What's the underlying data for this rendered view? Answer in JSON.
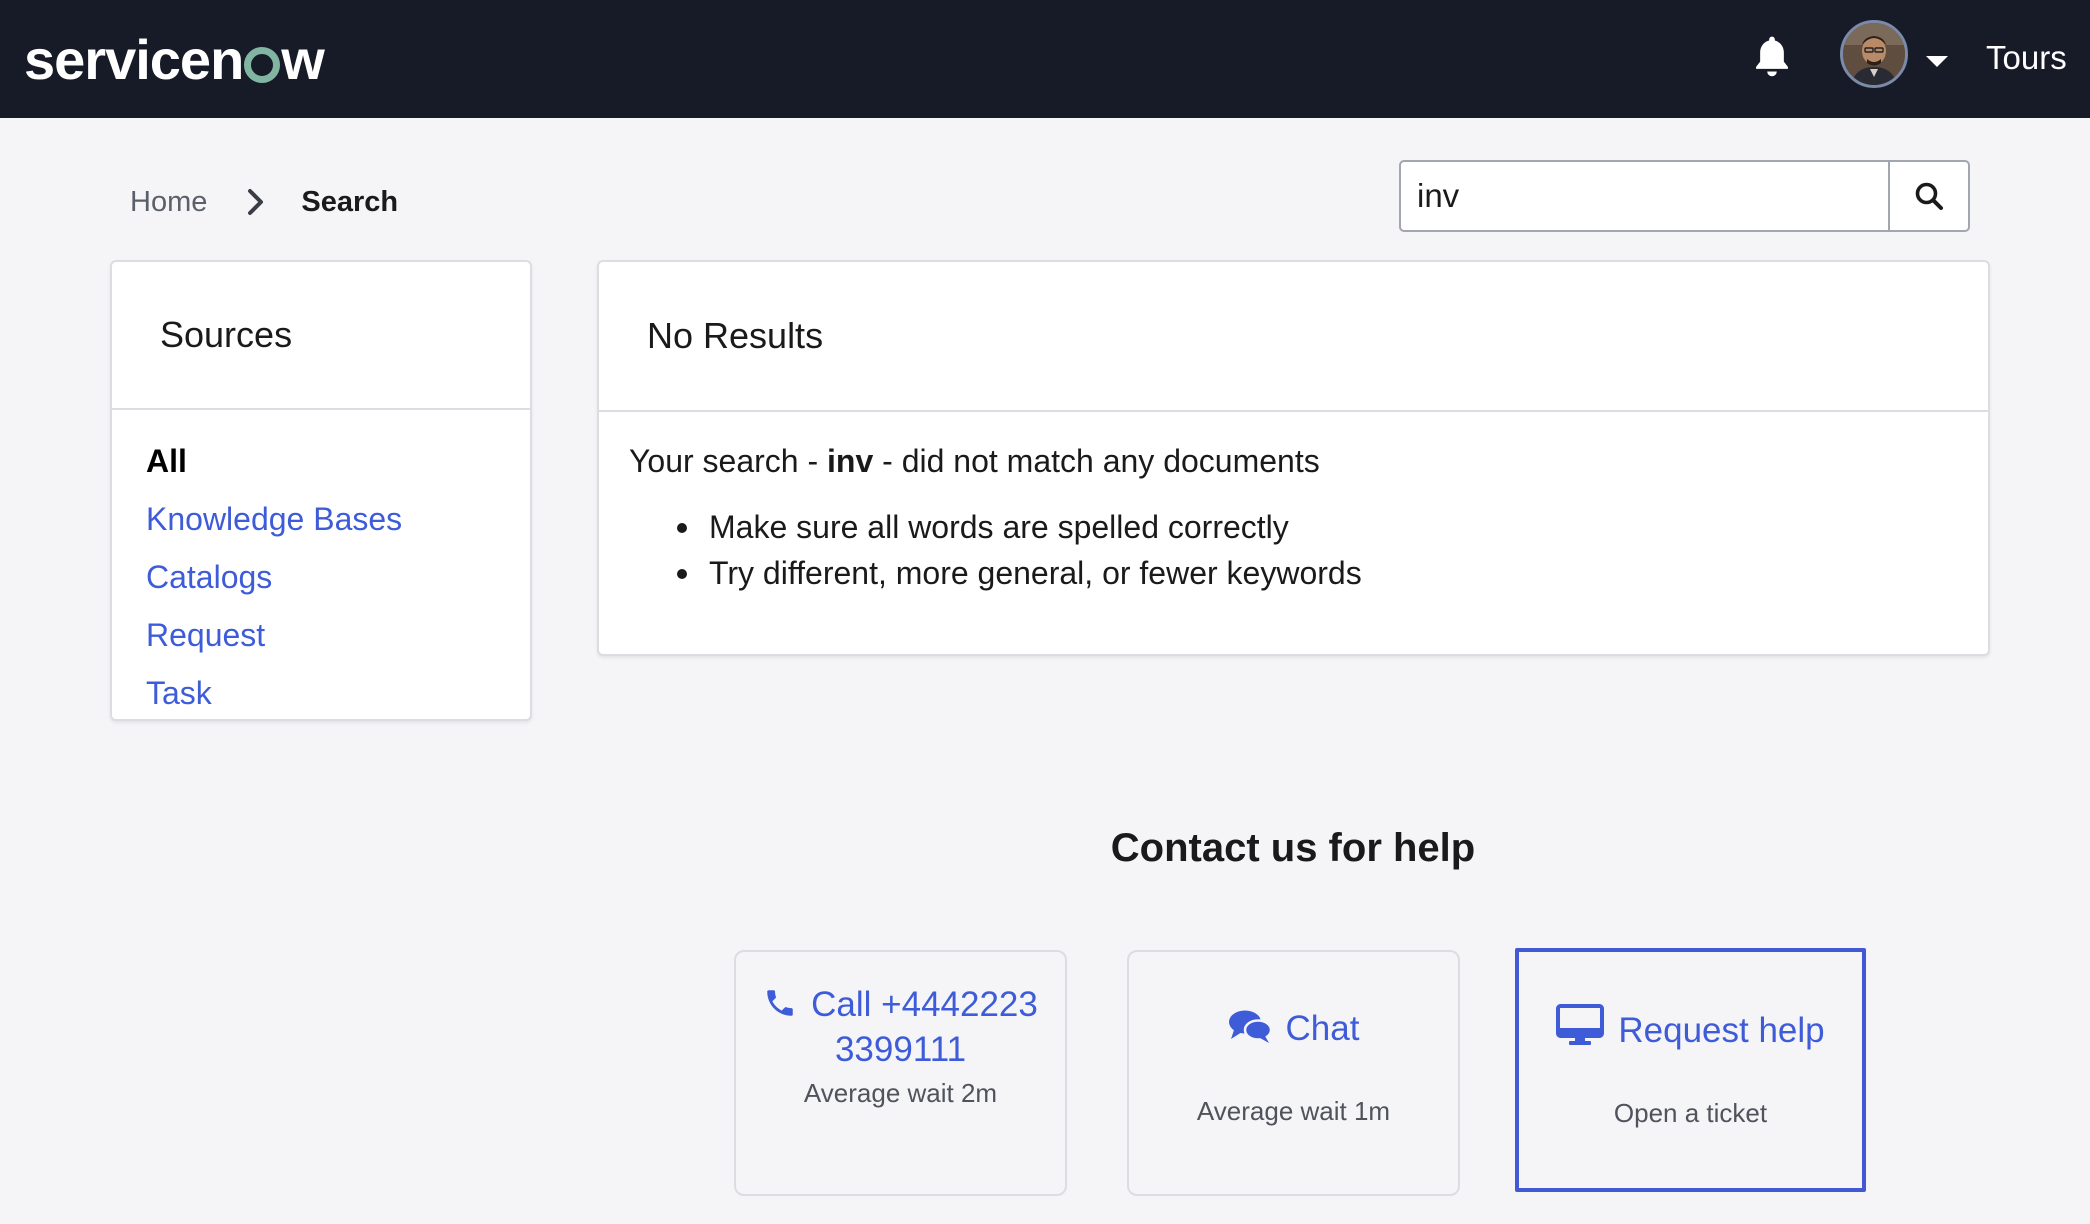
{
  "header": {
    "logo_text_a": "servicen",
    "logo_text_b": "w",
    "tours_label": "Tours",
    "icons": [
      "bell-icon",
      "avatar",
      "chevron-down-icon"
    ]
  },
  "breadcrumb": {
    "home": "Home",
    "current": "Search"
  },
  "search": {
    "value": "inv",
    "button_icon": "search-icon"
  },
  "sources": {
    "title": "Sources",
    "items": [
      {
        "label": "All",
        "active": true
      },
      {
        "label": "Knowledge Bases",
        "active": false
      },
      {
        "label": "Catalogs",
        "active": false
      },
      {
        "label": "Request",
        "active": false
      },
      {
        "label": "Task",
        "active": false
      }
    ]
  },
  "results": {
    "title": "No Results",
    "prefix": "Your search - ",
    "term": "inv",
    "suffix": " - did not match any documents",
    "tips": [
      "Make sure all words are spelled correctly",
      "Try different, more general, or fewer keywords"
    ]
  },
  "contact": {
    "title": "Contact us for help",
    "call": {
      "label": "Call +44422233399111",
      "sub": "Average wait 2m",
      "icon": "phone-icon"
    },
    "chat": {
      "label": "Chat",
      "sub": "Average wait 1m",
      "icon": "chat-icon"
    },
    "request": {
      "label": "Request help",
      "sub": "Open a ticket",
      "icon": "monitor-icon"
    }
  },
  "colors": {
    "topbar": "#171a27",
    "link": "#3e5cd8",
    "focus_border": "#4259d6",
    "page_bg": "#f5f5f7"
  }
}
